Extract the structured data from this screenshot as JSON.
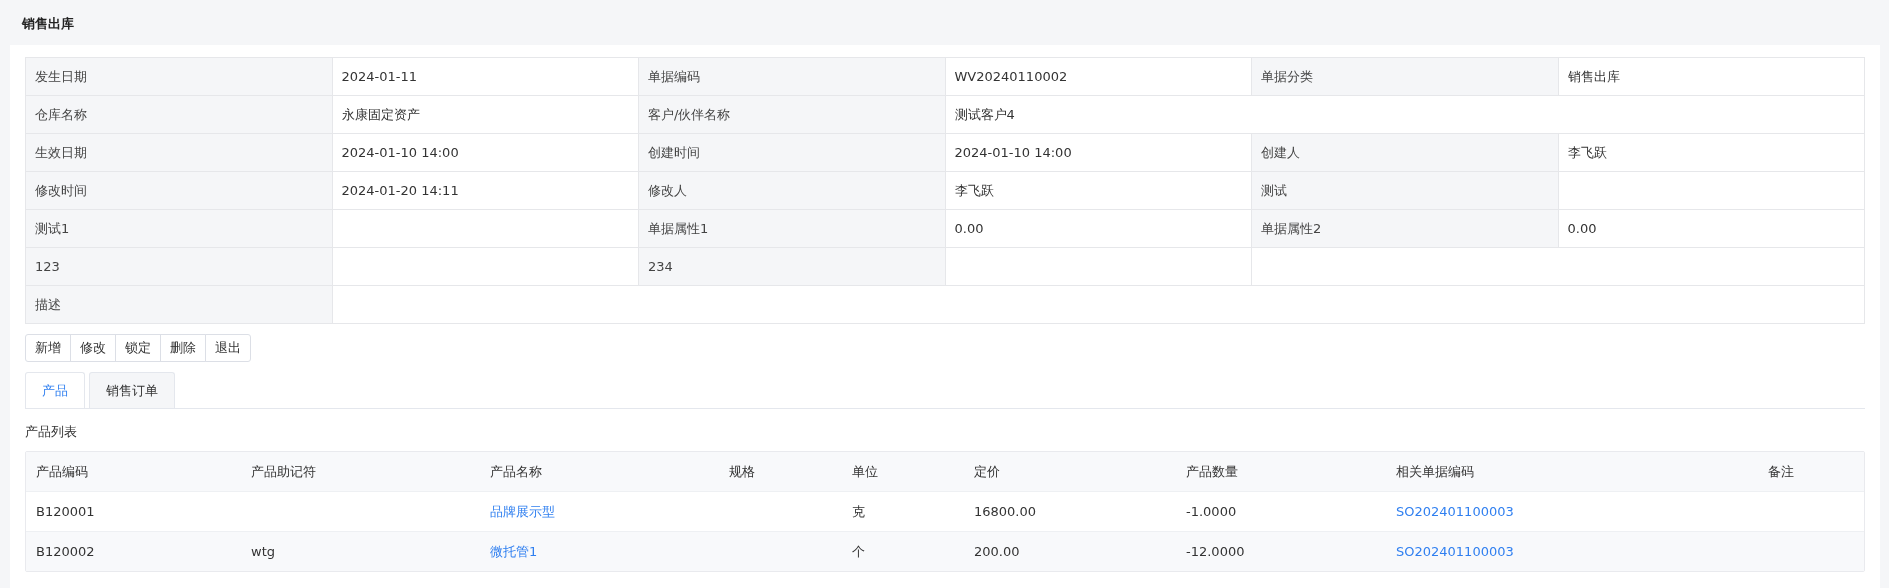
{
  "page_title": "销售出库",
  "details": [
    [
      {
        "kind": "label",
        "text": "发生日期"
      },
      {
        "kind": "value",
        "text": "2024-01-11"
      },
      {
        "kind": "label",
        "text": "单据编码"
      },
      {
        "kind": "value",
        "text": "WV20240110002"
      },
      {
        "kind": "label",
        "text": "单据分类"
      },
      {
        "kind": "value",
        "text": "销售出库"
      }
    ],
    [
      {
        "kind": "label",
        "text": "仓库名称"
      },
      {
        "kind": "value",
        "text": "永康固定资产"
      },
      {
        "kind": "label",
        "text": "客户/伙伴名称"
      },
      {
        "kind": "value",
        "text": "测试客户4"
      }
    ],
    [
      {
        "kind": "label",
        "text": "生效日期"
      },
      {
        "kind": "value",
        "text": "2024-01-10 14:00"
      },
      {
        "kind": "label",
        "text": "创建时间"
      },
      {
        "kind": "value",
        "text": "2024-01-10 14:00"
      },
      {
        "kind": "label",
        "text": "创建人"
      },
      {
        "kind": "value",
        "text": "李飞跃"
      }
    ],
    [
      {
        "kind": "label",
        "text": "修改时间"
      },
      {
        "kind": "value",
        "text": "2024-01-20 14:11"
      },
      {
        "kind": "label",
        "text": "修改人"
      },
      {
        "kind": "value",
        "text": "李飞跃"
      },
      {
        "kind": "label",
        "text": "测试"
      },
      {
        "kind": "value"
      }
    ],
    [
      {
        "kind": "label",
        "text": "测试1"
      },
      {
        "kind": "value"
      },
      {
        "kind": "label",
        "text": "单据属性1"
      },
      {
        "kind": "value",
        "text": "0.00"
      },
      {
        "kind": "label",
        "text": "单据属性2"
      },
      {
        "kind": "value",
        "text": "0.00"
      }
    ],
    [
      {
        "kind": "label",
        "text": "123"
      },
      {
        "kind": "value"
      },
      {
        "kind": "label",
        "text": "234"
      },
      {
        "kind": "value"
      },
      {
        "kind": "value"
      }
    ],
    [
      {
        "kind": "label",
        "text": "描述"
      },
      {
        "kind": "value"
      }
    ]
  ],
  "buttons": [
    "新增",
    "修改",
    "锁定",
    "删除",
    "退出"
  ],
  "tabs": [
    {
      "label": "产品",
      "selected": true
    },
    {
      "label": "销售订单",
      "selected": false
    }
  ],
  "section_title": "产品列表",
  "table": {
    "columns": [
      "产品编码",
      "产品助记符",
      "产品名称",
      "规格",
      "单位",
      "定价",
      "产品数量",
      "相关单据编码",
      "备注"
    ],
    "rows": [
      [
        {
          "kind": "text",
          "text": "B120001"
        },
        {
          "kind": "text"
        },
        {
          "kind": "link",
          "text": "品牌展示型"
        },
        {
          "kind": "text"
        },
        {
          "kind": "text",
          "text": "克"
        },
        {
          "kind": "text",
          "text": "16800.00"
        },
        {
          "kind": "text",
          "text": "-1.0000"
        },
        {
          "kind": "link",
          "text": "SO202401100003"
        },
        {
          "kind": "text"
        }
      ],
      [
        {
          "kind": "text",
          "text": "B120002"
        },
        {
          "kind": "text",
          "text": "wtg"
        },
        {
          "kind": "link",
          "text": "微托管1"
        },
        {
          "kind": "text"
        },
        {
          "kind": "text",
          "text": "个"
        },
        {
          "kind": "text",
          "text": "200.00"
        },
        {
          "kind": "text",
          "text": "-12.0000"
        },
        {
          "kind": "link",
          "text": "SO202401100003"
        },
        {
          "kind": "text"
        }
      ]
    ]
  }
}
